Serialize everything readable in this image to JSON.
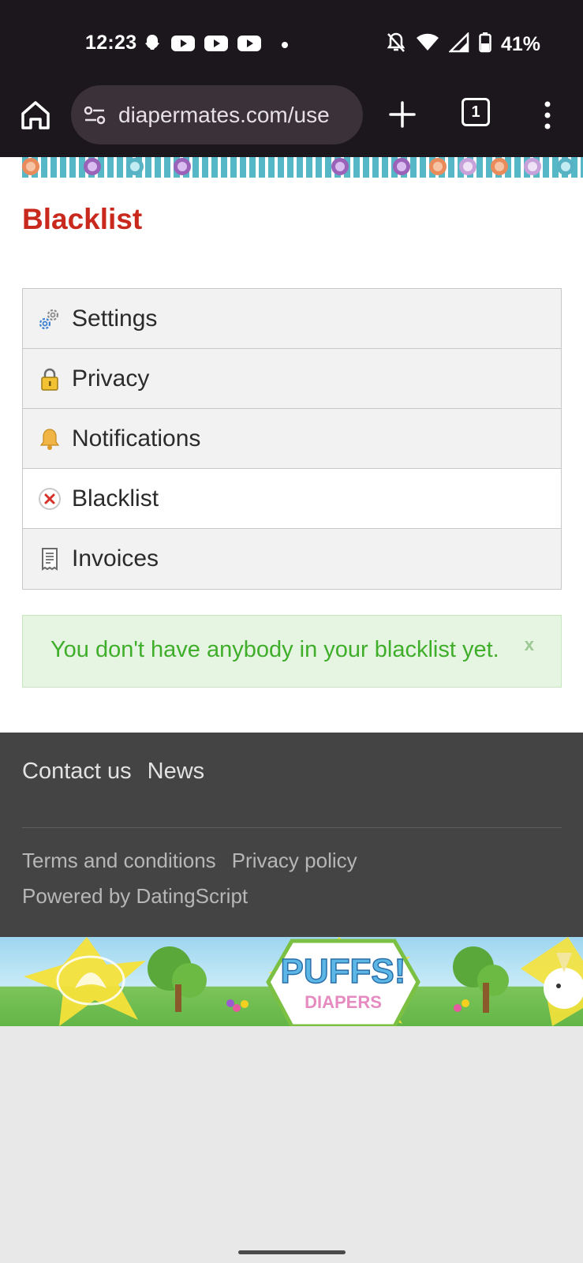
{
  "status_bar": {
    "time": "12:23",
    "left_icons": [
      "snapchat-icon",
      "youtube-icon",
      "youtube-icon",
      "youtube-icon",
      "dot-icon"
    ],
    "right_icons": [
      "bell-off-icon",
      "wifi-icon",
      "signal-icon",
      "battery-icon"
    ],
    "battery_text": "41%"
  },
  "browser": {
    "url": "diapermates.com/use",
    "tab_count": "1"
  },
  "page": {
    "title": "Blacklist",
    "menu_items": [
      {
        "label": "Settings",
        "icon": "gear-icon",
        "active": false
      },
      {
        "label": "Privacy",
        "icon": "lock-icon",
        "active": false
      },
      {
        "label": "Notifications",
        "icon": "bell-icon",
        "active": false
      },
      {
        "label": "Blacklist",
        "icon": "blocked-icon",
        "active": true
      },
      {
        "label": "Invoices",
        "icon": "receipt-icon",
        "active": false
      }
    ],
    "alert": {
      "message": "You don't have anybody in your blacklist yet.",
      "close_label": "x"
    }
  },
  "footer": {
    "primary_links": [
      "Contact us",
      "News"
    ],
    "secondary_links": [
      "Terms and conditions",
      "Privacy policy"
    ],
    "powered_by": "Powered by DatingScript"
  },
  "colors": {
    "title_red": "#c9281c",
    "alert_green_text": "#3fae2a",
    "alert_green_bg": "#e6f4e2",
    "footer_bg": "#444444",
    "browser_bg": "#1c171d"
  }
}
